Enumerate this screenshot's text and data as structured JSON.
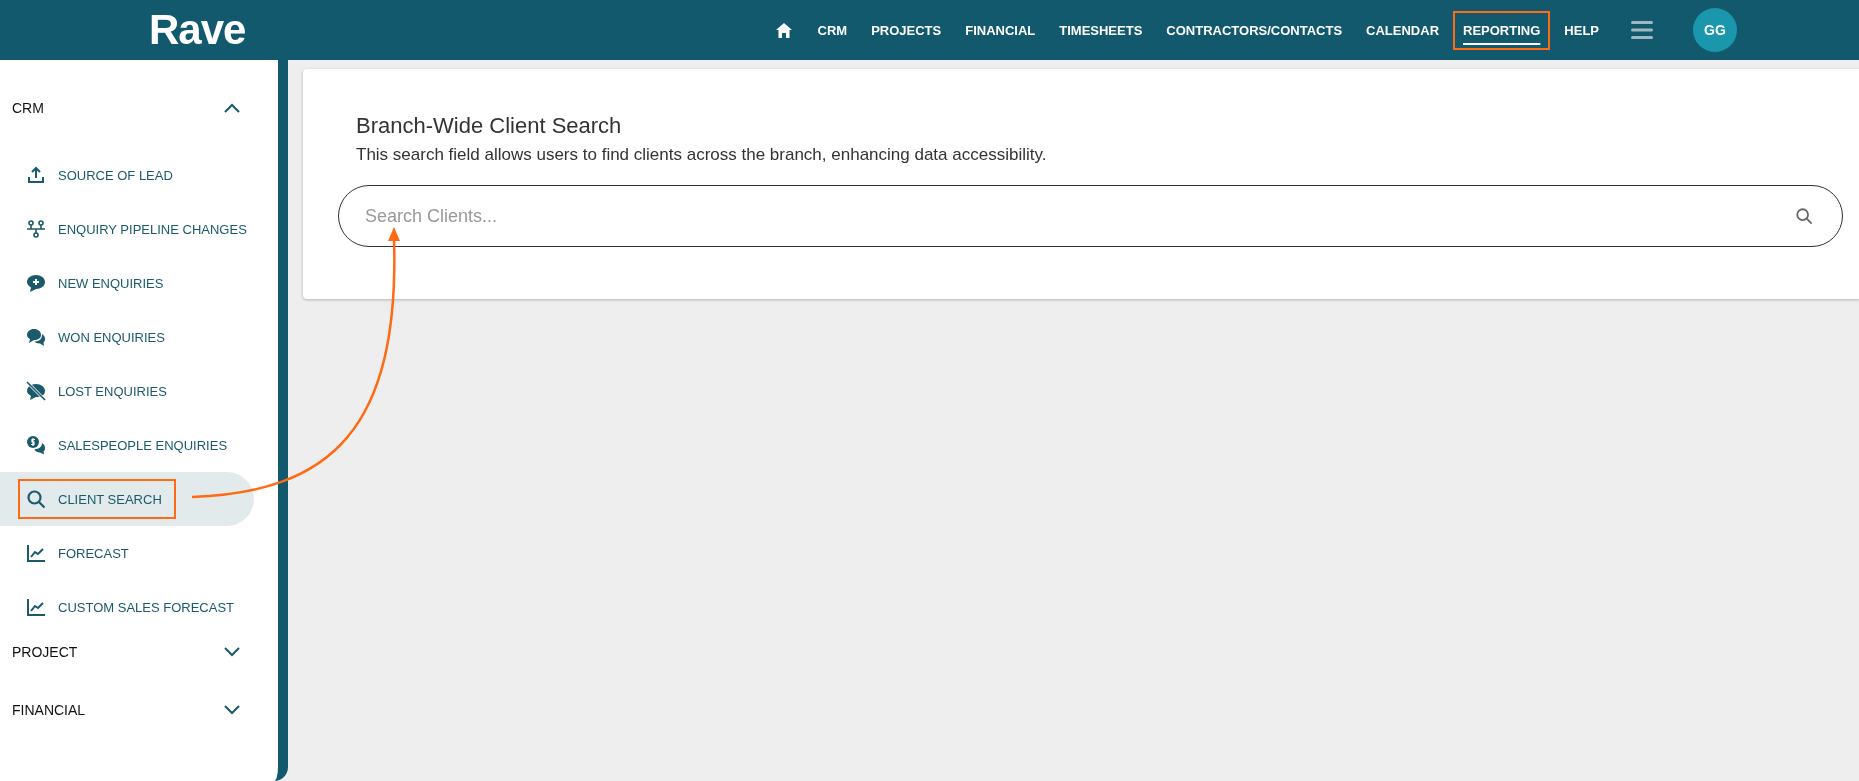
{
  "header": {
    "logo": "Rave",
    "nav": [
      {
        "kind": "home"
      },
      {
        "kind": "text",
        "label": "CRM",
        "selected": false,
        "highlighted": false
      },
      {
        "kind": "text",
        "label": "PROJECTS",
        "selected": false,
        "highlighted": false
      },
      {
        "kind": "text",
        "label": "FINANCIAL",
        "selected": false,
        "highlighted": false
      },
      {
        "kind": "text",
        "label": "TIMESHEETS",
        "selected": false,
        "highlighted": false
      },
      {
        "kind": "text",
        "label": "CONTRACTORS/CONTACTS",
        "selected": false,
        "highlighted": false
      },
      {
        "kind": "text",
        "label": "CALENDAR",
        "selected": false,
        "highlighted": false
      },
      {
        "kind": "text",
        "label": "REPORTING",
        "selected": true,
        "highlighted": true
      },
      {
        "kind": "text",
        "label": "HELP",
        "selected": false,
        "highlighted": false
      }
    ],
    "avatar": "GG"
  },
  "sidebar": {
    "sections": [
      {
        "label": "CRM",
        "expanded": true,
        "items": [
          {
            "kind": "upload",
            "label": "SOURCE OF LEAD",
            "selected": false,
            "highlighted": false
          },
          {
            "kind": "pipeline",
            "label": "ENQUIRY PIPELINE CHANGES",
            "selected": false,
            "highlighted": false
          },
          {
            "kind": "chat-plus",
            "label": "NEW ENQUIRIES",
            "selected": false,
            "highlighted": false
          },
          {
            "kind": "chats",
            "label": "WON ENQUIRIES",
            "selected": false,
            "highlighted": false
          },
          {
            "kind": "chat-off",
            "label": "LOST ENQUIRIES",
            "selected": false,
            "highlighted": false
          },
          {
            "kind": "chat-dollar",
            "label": "SALESPEOPLE ENQUIRIES",
            "selected": false,
            "highlighted": false
          },
          {
            "kind": "search",
            "label": "CLIENT SEARCH",
            "selected": true,
            "highlighted": true
          },
          {
            "kind": "chart",
            "label": "FORECAST",
            "selected": false,
            "highlighted": false
          },
          {
            "kind": "chart",
            "label": "CUSTOM SALES FORECAST",
            "selected": false,
            "highlighted": false
          }
        ]
      },
      {
        "label": "PROJECT",
        "expanded": false
      },
      {
        "label": "FINANCIAL",
        "expanded": false
      }
    ]
  },
  "card": {
    "title": "Branch-Wide Client Search",
    "description": "This search field allows users to find clients across the branch, enhancing data accessibility.",
    "search": {
      "placeholder": "Search Clients..."
    }
  }
}
